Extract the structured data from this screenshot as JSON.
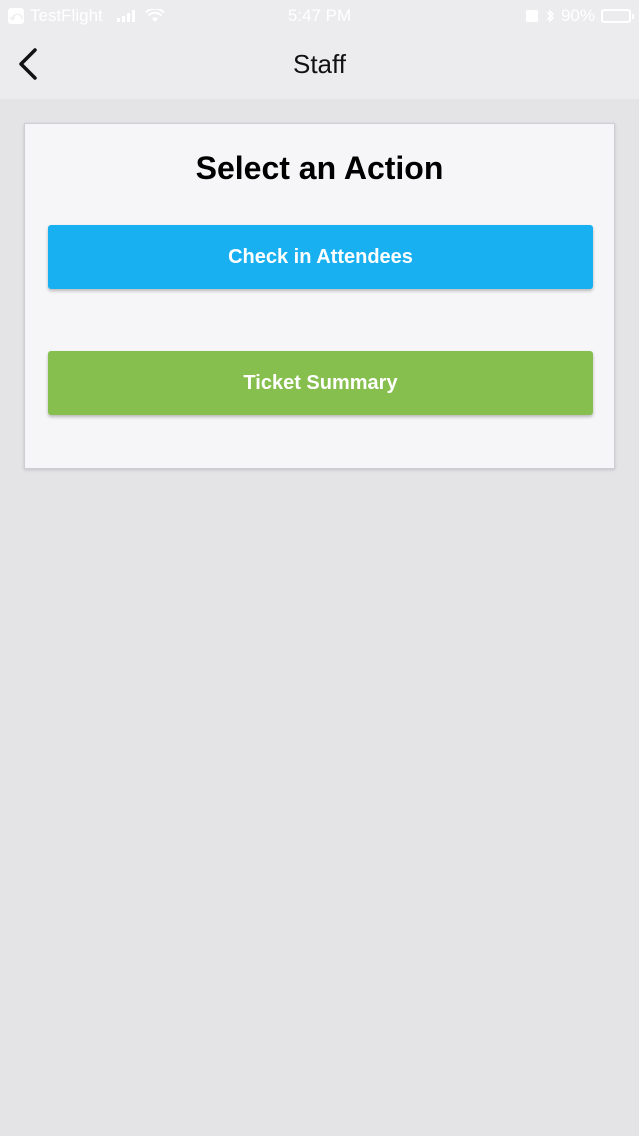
{
  "status_bar": {
    "carrier": "TestFlight",
    "carrier_icon": "testflight-icon",
    "time": "5:47 PM",
    "battery_text": "90%",
    "battery_level": 0.9
  },
  "nav": {
    "title": "Staff",
    "back_icon": "chevron-left-icon"
  },
  "card": {
    "title": "Select an Action",
    "buttons": [
      {
        "label": "Check in Attendees",
        "color": "#19b0f2"
      },
      {
        "label": "Ticket Summary",
        "color": "#86bf4d"
      }
    ]
  }
}
